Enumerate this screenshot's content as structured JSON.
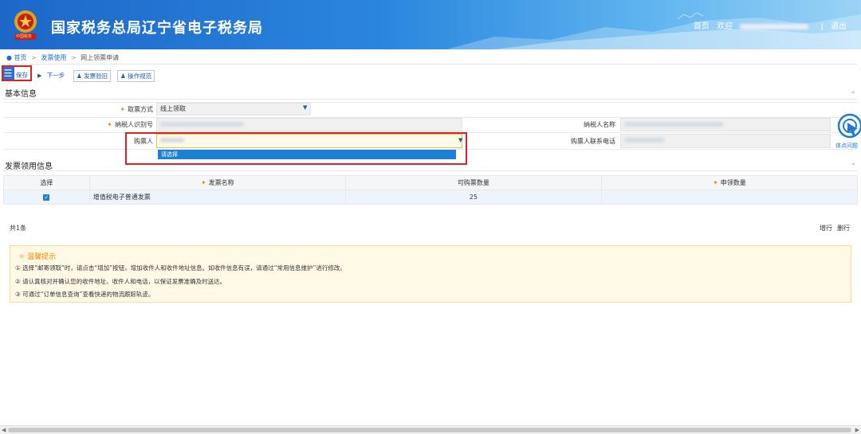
{
  "header": {
    "title": "国家税务总局辽宁省电子税务局",
    "nav": {
      "home": "首页",
      "welcome": "欢迎",
      "logout": "退出",
      "separator": "|"
    },
    "emblem_text": "中国税务"
  },
  "breadcrumb": {
    "items": [
      "首页",
      "发票使用",
      "网上领票申请"
    ]
  },
  "toolbar": {
    "save_label": "保存",
    "next_label": "下一步",
    "ticket_back_label": "发票验旧",
    "guide_label": "操作规范"
  },
  "basic_info": {
    "title": "基本信息",
    "receive_method": {
      "label": "取票方式",
      "value": "线上领取"
    },
    "taxpayer_id": {
      "label": "纳税人识别号"
    },
    "taxpayer_name": {
      "label": "纳税人名称"
    },
    "buyer": {
      "label": "购票人",
      "option": "请选择"
    },
    "buyer_phone": {
      "label": "购票人联系电话"
    }
  },
  "invoice_section": {
    "title": "发票领用信息",
    "columns": [
      "选择",
      "发票名称",
      "可购票数量",
      "申领数量"
    ],
    "rows": [
      {
        "checked": true,
        "name": "增值税电子普通发票",
        "available": "25",
        "apply": ""
      }
    ],
    "total": "共1条",
    "add_row": "增行",
    "delete_row": "删行"
  },
  "tips": {
    "title": "温馨提示",
    "lines": [
      "① 选择“邮寄领取”时，请点击“增加”按钮，增加收件人和收件地址信息。如收件信息有误，请通过“常用信息维护”进行修改。",
      "② 请认真核对并确认您的收件地址、收件人和电话，以保证发票准确及时送达。",
      "③ 可通过“订单信息查询”查看快递的物流跟踪轨迹。"
    ]
  },
  "float_button": {
    "label": "体点问题"
  },
  "colors": {
    "header_start": "#1d67c8",
    "accent": "#1c80d4",
    "highlight": "#e02020",
    "required": "#f08a00"
  }
}
